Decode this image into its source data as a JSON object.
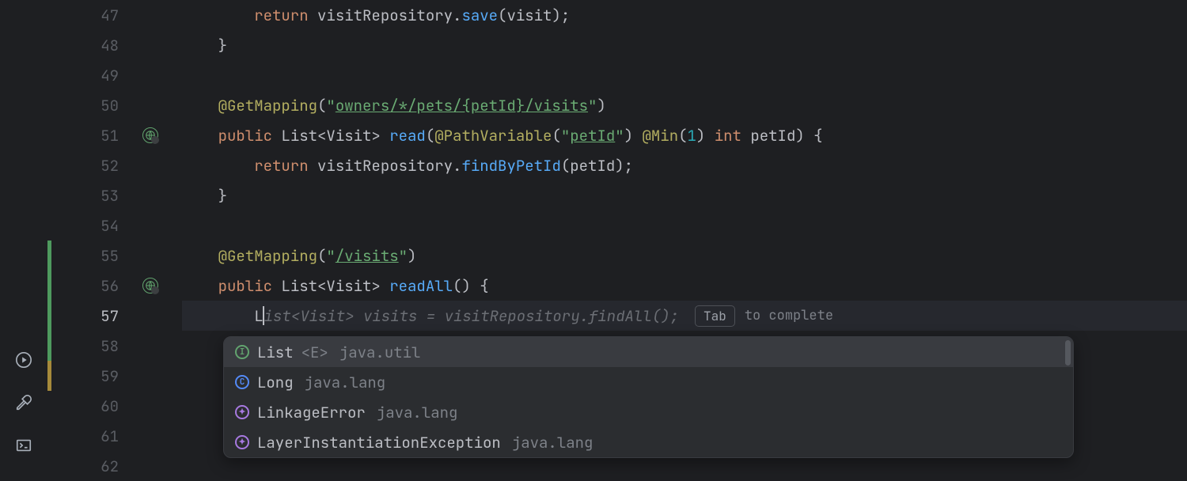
{
  "activity_icons": {
    "run": "run-icon",
    "build": "build-icon",
    "terminal": "terminal-icon"
  },
  "lines": [
    {
      "num": "47",
      "mark": "",
      "icon": "",
      "code": {
        "segs": [
          {
            "c": "p",
            "t": "        "
          },
          {
            "c": "kw",
            "t": "return"
          },
          {
            "c": "p",
            "t": " "
          },
          {
            "c": "id",
            "t": "visitRepository"
          },
          {
            "c": "p",
            "t": "."
          },
          {
            "c": "fn",
            "t": "save"
          },
          {
            "c": "p",
            "t": "(visit);"
          }
        ]
      }
    },
    {
      "num": "48",
      "mark": "",
      "icon": "",
      "code": {
        "segs": [
          {
            "c": "p",
            "t": "    }"
          }
        ]
      }
    },
    {
      "num": "49",
      "mark": "",
      "icon": "",
      "code": {
        "segs": []
      }
    },
    {
      "num": "50",
      "mark": "",
      "icon": "",
      "code": {
        "segs": [
          {
            "c": "p",
            "t": "    "
          },
          {
            "c": "ann",
            "t": "@GetMapping"
          },
          {
            "c": "p",
            "t": "("
          },
          {
            "c": "str",
            "t": "\""
          },
          {
            "c": "str-under",
            "t": "owners/*/pets/{petId}/visits"
          },
          {
            "c": "str",
            "t": "\""
          },
          {
            "c": "p",
            "t": ")"
          }
        ]
      }
    },
    {
      "num": "51",
      "mark": "",
      "icon": "globe",
      "code": {
        "segs": [
          {
            "c": "p",
            "t": "    "
          },
          {
            "c": "kw",
            "t": "public"
          },
          {
            "c": "p",
            "t": " "
          },
          {
            "c": "typ",
            "t": "List<Visit> "
          },
          {
            "c": "fn",
            "t": "read"
          },
          {
            "c": "p",
            "t": "("
          },
          {
            "c": "ann",
            "t": "@PathVariable"
          },
          {
            "c": "p",
            "t": "("
          },
          {
            "c": "str",
            "t": "\""
          },
          {
            "c": "str-under",
            "t": "petId"
          },
          {
            "c": "str",
            "t": "\""
          },
          {
            "c": "p",
            "t": ") "
          },
          {
            "c": "ann",
            "t": "@Min"
          },
          {
            "c": "p",
            "t": "("
          },
          {
            "c": "num",
            "t": "1"
          },
          {
            "c": "p",
            "t": ") "
          },
          {
            "c": "kw",
            "t": "int"
          },
          {
            "c": "p",
            "t": " petId) {"
          }
        ]
      }
    },
    {
      "num": "52",
      "mark": "",
      "icon": "",
      "code": {
        "segs": [
          {
            "c": "p",
            "t": "        "
          },
          {
            "c": "kw",
            "t": "return"
          },
          {
            "c": "p",
            "t": " "
          },
          {
            "c": "id",
            "t": "visitRepository"
          },
          {
            "c": "p",
            "t": "."
          },
          {
            "c": "fn",
            "t": "findByPetId"
          },
          {
            "c": "p",
            "t": "(petId);"
          }
        ]
      }
    },
    {
      "num": "53",
      "mark": "",
      "icon": "",
      "code": {
        "segs": [
          {
            "c": "p",
            "t": "    }"
          }
        ]
      }
    },
    {
      "num": "54",
      "mark": "",
      "icon": "",
      "code": {
        "segs": []
      }
    },
    {
      "num": "55",
      "mark": "green",
      "icon": "",
      "code": {
        "segs": [
          {
            "c": "p",
            "t": "    "
          },
          {
            "c": "ann",
            "t": "@GetMapping"
          },
          {
            "c": "p",
            "t": "("
          },
          {
            "c": "str",
            "t": "\""
          },
          {
            "c": "str-under",
            "t": "/visits"
          },
          {
            "c": "str",
            "t": "\""
          },
          {
            "c": "p",
            "t": ")"
          }
        ]
      }
    },
    {
      "num": "56",
      "mark": "green",
      "icon": "globe",
      "code": {
        "segs": [
          {
            "c": "p",
            "t": "    "
          },
          {
            "c": "kw",
            "t": "public"
          },
          {
            "c": "p",
            "t": " "
          },
          {
            "c": "typ",
            "t": "List<Visit> "
          },
          {
            "c": "fn",
            "t": "readAll"
          },
          {
            "c": "p",
            "t": "() {"
          }
        ]
      }
    },
    {
      "num": "57",
      "mark": "green",
      "icon": "",
      "active": true,
      "code": {
        "segs": [
          {
            "c": "p",
            "t": "        "
          },
          {
            "c": "id",
            "t": "L"
          }
        ],
        "cursor": true,
        "ghost": "ist<Visit> visits = visitRepository.findAll();",
        "tab": {
          "key": "Tab",
          "label": "to complete"
        }
      }
    },
    {
      "num": "58",
      "mark": "green",
      "icon": "",
      "code": {
        "segs": []
      }
    },
    {
      "num": "59",
      "mark": "yellow",
      "icon": "",
      "code": {
        "segs": []
      }
    },
    {
      "num": "60",
      "mark": "",
      "icon": "",
      "code": {
        "segs": []
      }
    },
    {
      "num": "61",
      "mark": "",
      "icon": "",
      "code": {
        "segs": []
      }
    },
    {
      "num": "62",
      "mark": "",
      "icon": "",
      "code": {
        "segs": []
      }
    }
  ],
  "autocomplete": {
    "items": [
      {
        "icon": "I",
        "iconColor": "green",
        "name": "List",
        "type": "<E>",
        "pkg": "java.util",
        "selected": true
      },
      {
        "icon": "C",
        "iconColor": "blue",
        "name": "Long",
        "type": "",
        "pkg": "java.lang"
      },
      {
        "icon": "✦",
        "iconColor": "purple",
        "name": "LinkageError",
        "type": "",
        "pkg": "java.lang"
      },
      {
        "icon": "✦",
        "iconColor": "purple",
        "name": "LayerInstantiationException",
        "type": "",
        "pkg": "java.lang"
      }
    ]
  }
}
